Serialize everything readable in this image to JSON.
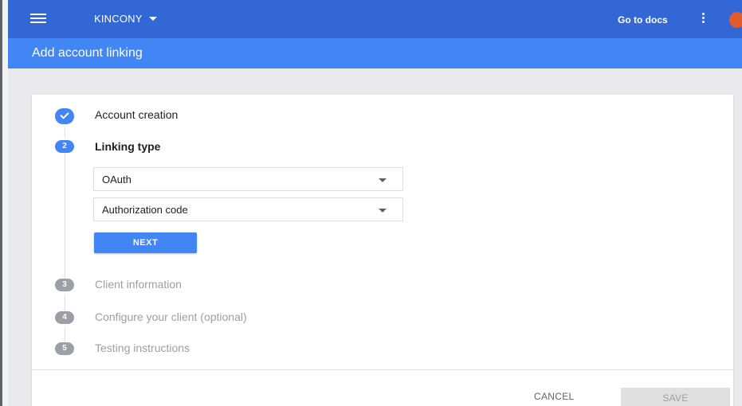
{
  "topbar": {
    "project_name": "KINCONY",
    "docs_label": "Go to docs",
    "avatar_color": "#e25c2c"
  },
  "page": {
    "title": "Add account linking"
  },
  "steps": [
    {
      "number": "",
      "label": "Account creation",
      "state": "completed"
    },
    {
      "number": "2",
      "label": "Linking type",
      "state": "active"
    },
    {
      "number": "3",
      "label": "Client information",
      "state": "pending"
    },
    {
      "number": "4",
      "label": "Configure your client (optional)",
      "state": "pending"
    },
    {
      "number": "5",
      "label": "Testing instructions",
      "state": "pending"
    }
  ],
  "linking_type": {
    "grant_select": {
      "value": "OAuth"
    },
    "flow_select": {
      "value": "Authorization code"
    },
    "next_label": "NEXT"
  },
  "footer": {
    "cancel_label": "CANCEL",
    "save_label": "SAVE"
  },
  "colors": {
    "topbar": "#3367d6",
    "subbar": "#4285f4",
    "accent": "#4285f4",
    "muted": "#9aa0a6"
  }
}
